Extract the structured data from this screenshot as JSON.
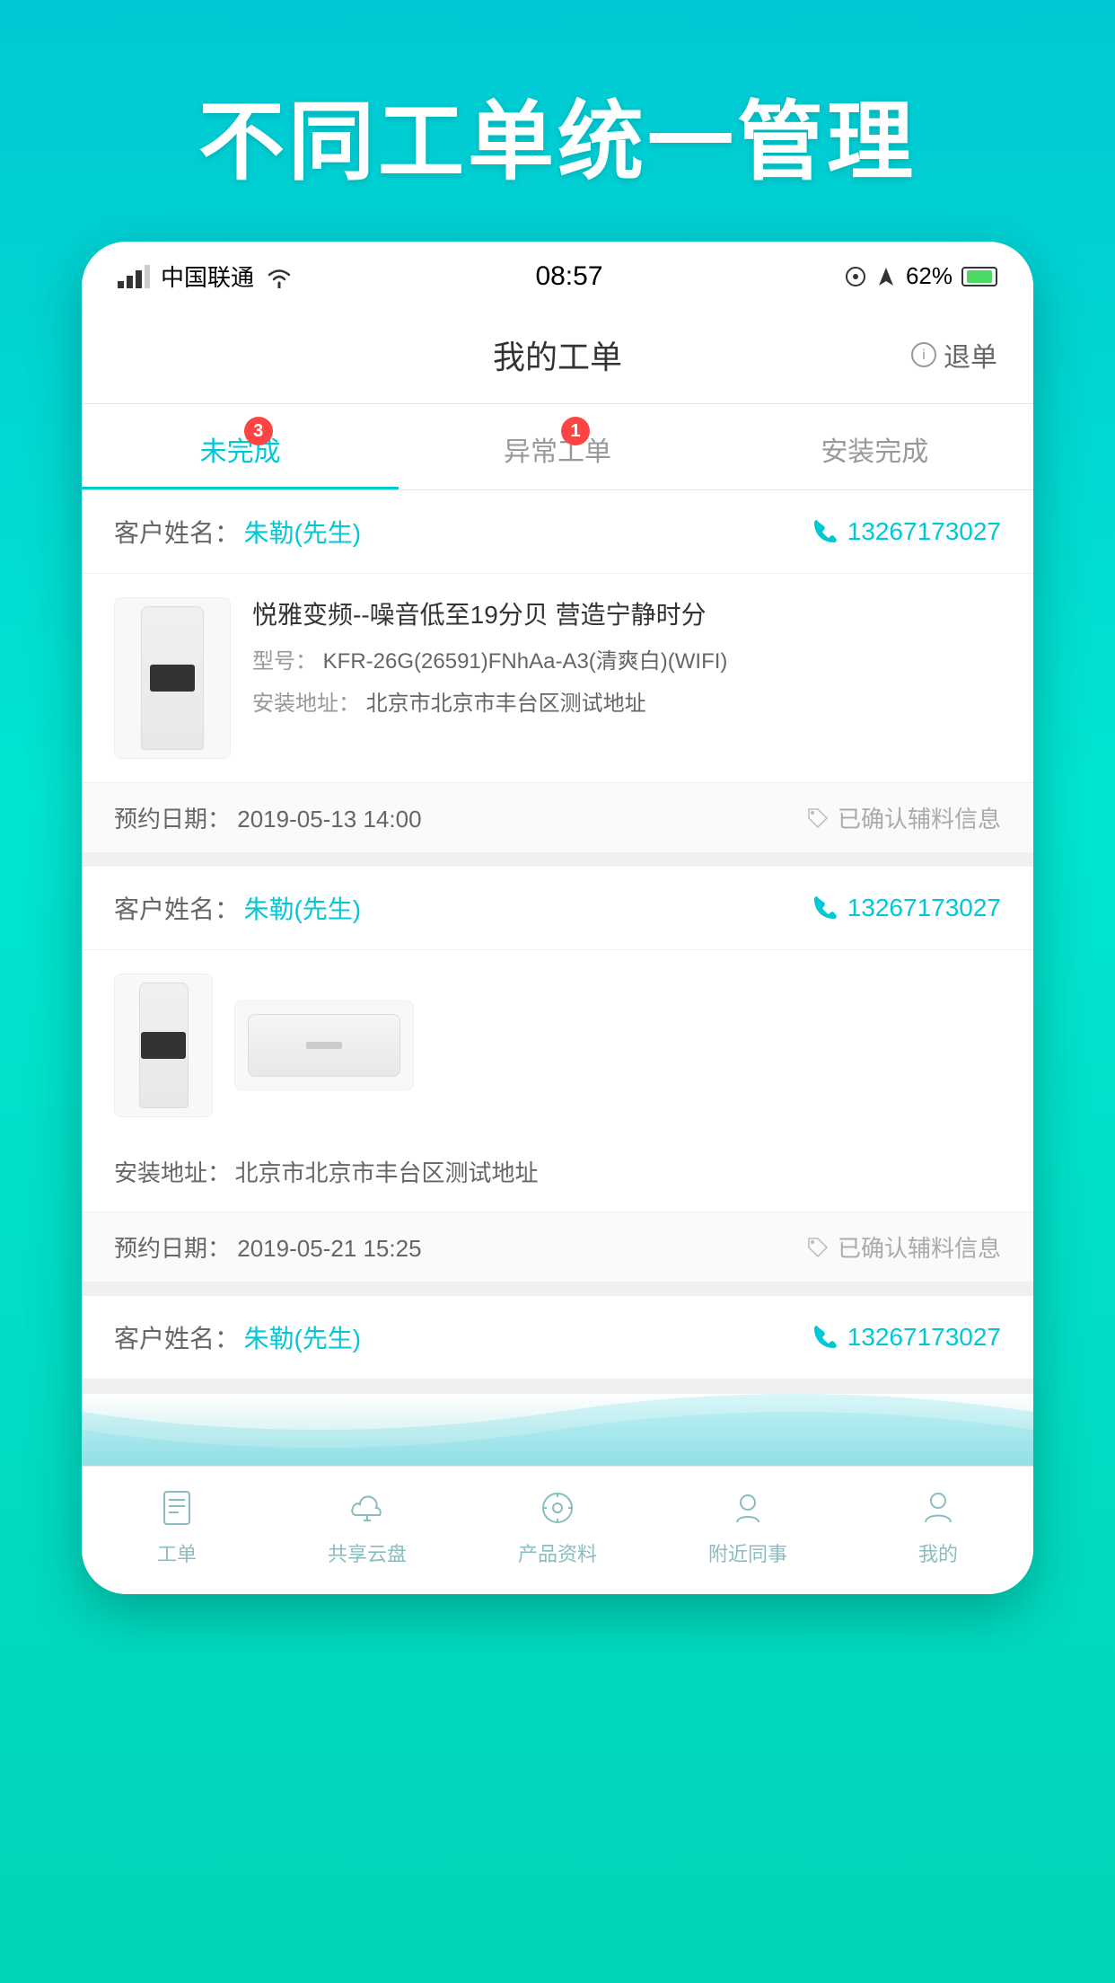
{
  "hero": {
    "title": "不同工单统一管理"
  },
  "status_bar": {
    "carrier": "中国联通",
    "wifi": "WiFi",
    "time": "08:57",
    "battery": "62%"
  },
  "header": {
    "title": "我的工单",
    "action": "退单"
  },
  "tabs": [
    {
      "label": "未完成",
      "badge": "3",
      "active": true
    },
    {
      "label": "异常工单",
      "badge": "1",
      "active": false
    },
    {
      "label": "安装完成",
      "badge": "",
      "active": false
    }
  ],
  "orders": [
    {
      "customer_label": "客户姓名：",
      "customer_name": "朱勒(先生)",
      "phone": "13267173027",
      "product_name": "悦雅变频--噪音低至19分贝 营造宁静时分",
      "model_label": "型号：",
      "model": "KFR-26G(26591)FNhAa-A3(清爽白)(WIFI)",
      "address_label": "安装地址：",
      "address": "北京市北京市丰台区测试地址",
      "appt_label": "预约日期：",
      "appt_date": "2019-05-13 14:00",
      "confirmed": "已确认辅料信息"
    },
    {
      "customer_label": "客户姓名：",
      "customer_name": "朱勒(先生)",
      "phone": "13267173027",
      "address_label": "安装地址：",
      "address": "北京市北京市丰台区测试地址",
      "appt_label": "预约日期：",
      "appt_date": "2019-05-21 15:25",
      "confirmed": "已确认辅料信息"
    },
    {
      "customer_label": "客户姓名：",
      "customer_name": "朱勒(先生)",
      "phone": "13267173027"
    }
  ],
  "bottom_nav": [
    {
      "label": "工单",
      "active": false,
      "icon": "workorder-icon"
    },
    {
      "label": "共享云盘",
      "active": false,
      "icon": "cloud-icon"
    },
    {
      "label": "产品资料",
      "active": false,
      "icon": "product-icon"
    },
    {
      "label": "附近同事",
      "active": false,
      "icon": "nearby-icon"
    },
    {
      "label": "我的",
      "active": false,
      "icon": "profile-icon"
    }
  ]
}
